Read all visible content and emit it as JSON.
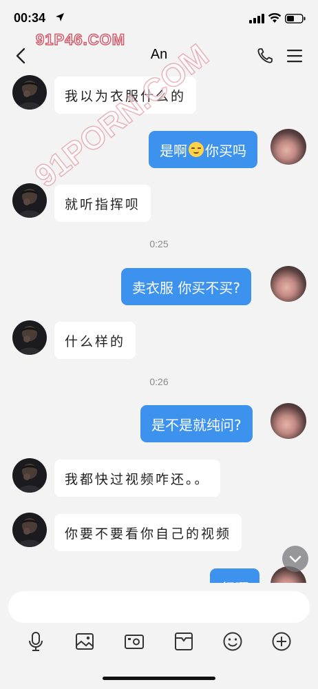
{
  "status_bar": {
    "time": "00:34"
  },
  "watermark": {
    "top": "91P46.COM",
    "diagonal": "91PORN.COM"
  },
  "header": {
    "title": "An"
  },
  "messages": [
    {
      "from": "them",
      "text": "我以为衣服什么的"
    },
    {
      "from": "me",
      "text_before": "是啊",
      "emoji": "blush-emoji",
      "text_after": "你买吗"
    },
    {
      "from": "them",
      "text": "就听指挥呗"
    },
    {
      "from": "time",
      "text": "0:25"
    },
    {
      "from": "me",
      "text": "卖衣服 你买不买?"
    },
    {
      "from": "them",
      "text": "什么样的"
    },
    {
      "from": "time",
      "text": "0:26"
    },
    {
      "from": "me",
      "text": "是不是就纯问?"
    },
    {
      "from": "them",
      "text": "我都快过视频咋还。。"
    },
    {
      "from": "them",
      "text": "你要不要看你自己的视频"
    },
    {
      "from": "me",
      "text": "行啊"
    }
  ],
  "composer": {
    "placeholder": ""
  },
  "toolbar": {
    "icons": [
      "microphone-icon",
      "image-icon",
      "camera-icon",
      "inbox-icon",
      "emoji-icon",
      "plus-icon"
    ]
  },
  "colors": {
    "outgoing_bubble": "#3d92ee",
    "incoming_bubble": "#ffffff",
    "background": "#f3f3f3"
  }
}
